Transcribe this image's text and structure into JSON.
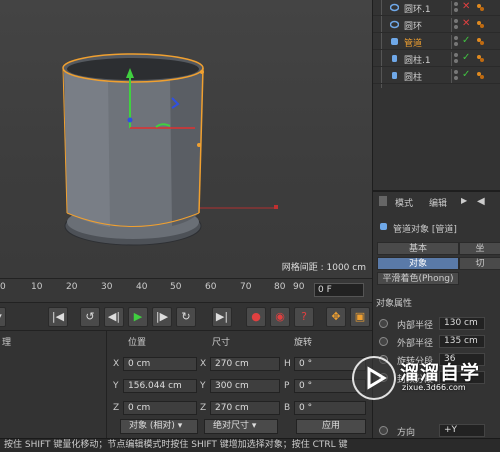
{
  "viewport": {
    "grid_distance": "网格间距 : 1000 cm"
  },
  "object_manager": {
    "items": [
      {
        "name": "圆环.1",
        "icon": "torus-icon",
        "state": "✕",
        "state_color": "#e04040"
      },
      {
        "name": "圆环",
        "icon": "torus-icon",
        "state": "✕",
        "state_color": "#e04040"
      },
      {
        "name": "管道",
        "icon": "tube-icon",
        "state": "✓",
        "state_color": "#40c040",
        "selected": true
      },
      {
        "name": "圆柱.1",
        "icon": "cylinder-icon",
        "state": "✓",
        "state_color": "#40c040"
      },
      {
        "name": "圆柱",
        "icon": "cylinder-icon",
        "state": "✓",
        "state_color": "#40c040"
      }
    ]
  },
  "attributes": {
    "menu": {
      "mode": "模式",
      "edit": "编辑"
    },
    "title": "管道对象 [管道]",
    "tabs": [
      "基本",
      "坐",
      "对象",
      "切"
    ],
    "phong_tab": "平滑着色(Phong)",
    "section": "对象属性",
    "props": [
      {
        "label": "内部半径",
        "value": "130 cm"
      },
      {
        "label": "外部半径",
        "value": "135 cm"
      },
      {
        "label": "旋转分段",
        "value": "36"
      },
      {
        "label": "封顶分段",
        "value": "1"
      },
      {
        "label": "方向",
        "value": "+Y"
      }
    ]
  },
  "timeline": {
    "ticks": [
      "0",
      "10",
      "20",
      "30",
      "40",
      "50",
      "60",
      "70",
      "80",
      "90"
    ],
    "current_frame": "0 F"
  },
  "coordinates": {
    "headers": {
      "position": "位置",
      "size": "尺寸",
      "rotation": "旋转",
      "left": "理"
    },
    "rows": [
      {
        "axis": "X",
        "pos": "0 cm",
        "size_axis": "X",
        "size": "270 cm",
        "rot_axis": "H",
        "rot": "0 °"
      },
      {
        "axis": "Y",
        "pos": "156.044 cm",
        "size_axis": "Y",
        "size": "300 cm",
        "rot_axis": "P",
        "rot": "0 °"
      },
      {
        "axis": "Z",
        "pos": "0 cm",
        "size_axis": "Z",
        "size": "270 cm",
        "rot_axis": "B",
        "rot": "0 °"
      }
    ],
    "mode_dropdown": "对象 (相对)",
    "size_dropdown": "绝对尺寸",
    "apply_label": "应用"
  },
  "status_text": "按住 SHIFT 键量化移动；节点编辑模式时按住 SHIFT 键增加选择对象；按住 CTRL 键",
  "watermark": {
    "cn": "溜溜自学",
    "url": "zixue.3d66.com"
  },
  "colors": {
    "accent": "#f0a030",
    "selection_blue": "#5a7aa8"
  }
}
